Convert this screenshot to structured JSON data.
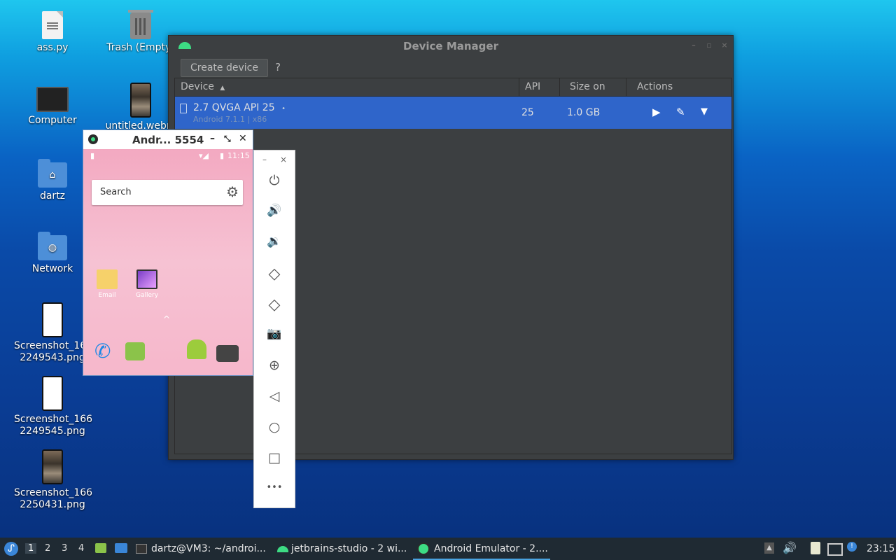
{
  "desktop": {
    "icons": [
      {
        "label": "ass.py",
        "icon": "python-file-icon"
      },
      {
        "label": "Trash (Empty)",
        "icon": "trash-icon"
      },
      {
        "label": "Computer",
        "icon": "computer-icon"
      },
      {
        "label": "untitled.webm",
        "icon": "video-file-icon"
      },
      {
        "label": "dartz",
        "icon": "home-folder-icon"
      },
      {
        "label": "Network",
        "icon": "network-folder-icon"
      },
      {
        "label": "Screenshot_1662249543.png",
        "line1": "Screenshot_166",
        "line2": "2249543.png",
        "icon": "image-file-icon"
      },
      {
        "label": "Screenshot_1662249545.png",
        "line1": "Screenshot_166",
        "line2": "2249545.png",
        "icon": "image-file-icon"
      },
      {
        "label": "Screenshot_1662250431.png",
        "line1": "Screenshot_166",
        "line2": "2250431.png",
        "icon": "image-file-icon"
      }
    ]
  },
  "device_manager": {
    "title": "Device Manager",
    "create_label": "Create device",
    "help_label": "?",
    "columns": [
      "Device",
      "API",
      "Size on Disk",
      "Actions"
    ],
    "sort_indicator": "▲",
    "row": {
      "name": "2.7  QVGA API 25",
      "dot": "•",
      "sub": "Android 7.1.1 | x86",
      "api": "25",
      "size": "1.0 GB"
    },
    "accent": "#2f65ca"
  },
  "emulator": {
    "title": "Andr... 5554",
    "min": "–",
    "restore": "⤡",
    "close": "✕",
    "status_time": "11:15",
    "search_label": "Search",
    "apps": [
      "Email",
      "Gallery"
    ],
    "drawer_arrow": "^"
  },
  "side_toolbar": {
    "min": "–",
    "close": "×",
    "controls": [
      {
        "name": "power-icon",
        "glyph": "⏻"
      },
      {
        "name": "volume-up-icon",
        "glyph": "🔊"
      },
      {
        "name": "volume-down-icon",
        "glyph": "🔉"
      },
      {
        "name": "rotate-left-icon",
        "glyph": "◇"
      },
      {
        "name": "rotate-right-icon",
        "glyph": "◇"
      },
      {
        "name": "camera-icon",
        "glyph": "📷"
      },
      {
        "name": "zoom-icon",
        "glyph": "⊕"
      },
      {
        "name": "back-icon",
        "glyph": "◁"
      },
      {
        "name": "home-icon",
        "glyph": "○"
      },
      {
        "name": "overview-icon",
        "glyph": "□"
      },
      {
        "name": "more-icon",
        "glyph": "•••"
      }
    ]
  },
  "taskbar": {
    "workspaces": [
      "1",
      "2",
      "3",
      "4"
    ],
    "tasks": [
      "dartz@VM3: ~/androi...",
      "jetbrains-studio - 2 wi...",
      "Android Emulator - 2...."
    ],
    "clock": "23:15"
  }
}
